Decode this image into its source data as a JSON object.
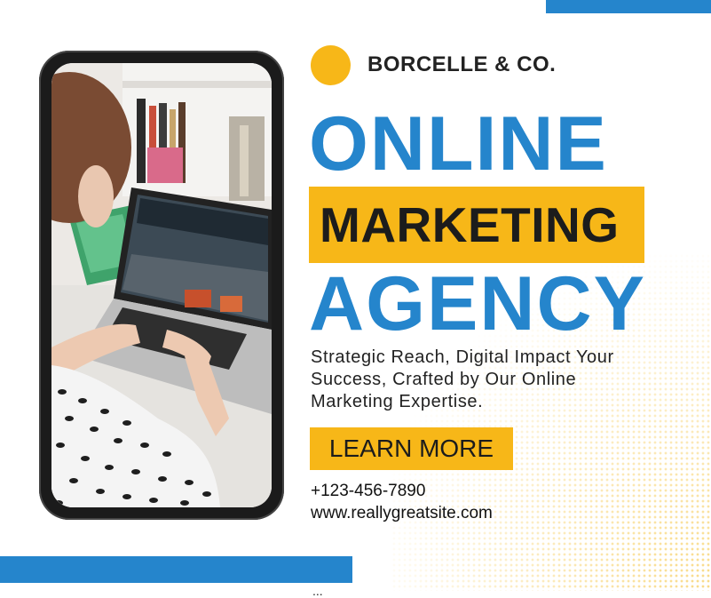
{
  "brand": {
    "name": "BORCELLE & CO."
  },
  "headline": {
    "line1": "ONLINE",
    "line2": "MARKETING",
    "line3": "AGENCY"
  },
  "tagline": {
    "line1": "Strategic Reach, Digital Impact Your",
    "line2": "Success, Crafted by Our Online",
    "line3": "Marketing Expertise."
  },
  "cta": {
    "label": "LEARN MORE"
  },
  "contact": {
    "phone": "+123-456-7890",
    "website": "www.reallygreatsite.com",
    "cut_off": "..."
  },
  "colors": {
    "blue": "#2585cc",
    "yellow": "#f7b718",
    "dark": "#1c1c1c"
  },
  "photo": {
    "icon": "person-laptop-photo"
  }
}
